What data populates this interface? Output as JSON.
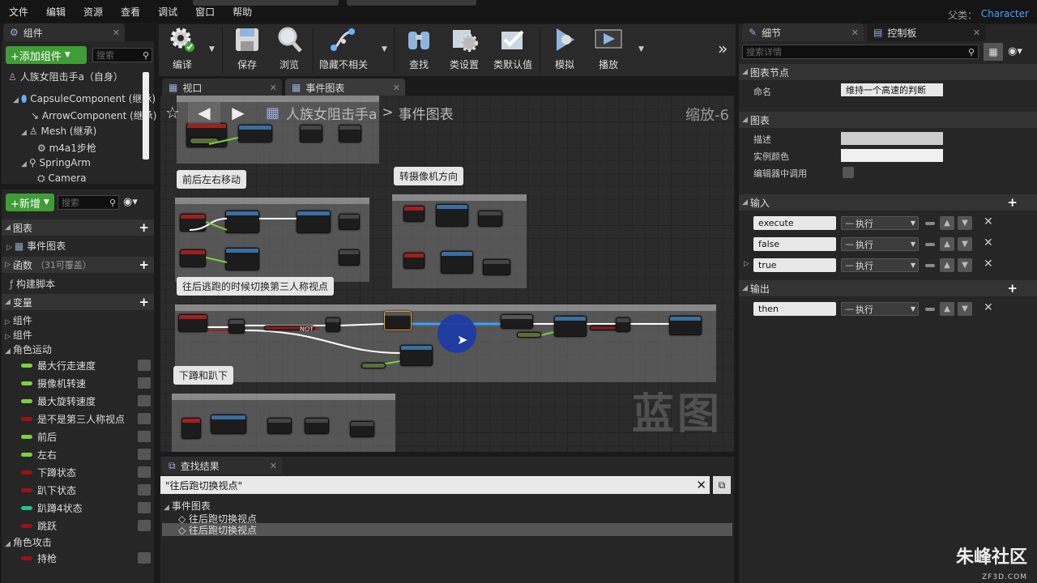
{
  "menu": [
    "文件",
    "编辑",
    "资源",
    "查看",
    "调试",
    "窗口",
    "帮助"
  ],
  "parent": {
    "label": "父类：",
    "value": "Character"
  },
  "components": {
    "tab": "组件",
    "add_button": "+添加组件",
    "search_placeholder": "搜索",
    "tree": [
      "人族女阻击手a（自身）",
      "CapsuleComponent (继承)",
      "ArrowComponent (继承)",
      "Mesh (继承)",
      "m4a1步枪",
      "SpringArm",
      "Camera"
    ]
  },
  "my_blueprint": {
    "new_button": "+新增",
    "search_placeholder": "搜索",
    "sections": {
      "graphs": "图表",
      "event_graph": "事件图表",
      "functions": "函数",
      "functions_override": "（31可覆盖）",
      "construction": "构建脚本",
      "variables": "变量"
    },
    "categories": [
      "组件",
      "组件",
      "角色运动"
    ],
    "variables": [
      {
        "name": "最大行走速度",
        "color": "#7bd23b"
      },
      {
        "name": "摄像机转速",
        "color": "#7bd23b"
      },
      {
        "name": "最大旋转速度",
        "color": "#7bd23b"
      },
      {
        "name": "是不是第三人称视点",
        "color": "#a01010"
      },
      {
        "name": "前后",
        "color": "#7bd23b"
      },
      {
        "name": "左右",
        "color": "#7bd23b"
      },
      {
        "name": "下蹲状态",
        "color": "#a01010"
      },
      {
        "name": "趴下状态",
        "color": "#a01010"
      },
      {
        "name": "趴蹲4状态",
        "color": "#1ec28a"
      },
      {
        "name": "跳跃",
        "color": "#a01010"
      }
    ],
    "attack_category": "角色攻击",
    "attack_variables": [
      {
        "name": "持枪",
        "color": "#a01010"
      }
    ]
  },
  "toolbar": {
    "compile": "编译",
    "save": "保存",
    "browse": "浏览",
    "hide_unrelated": "隐藏不相关",
    "find": "查找",
    "class_settings": "类设置",
    "class_defaults": "类默认值",
    "simulate": "模拟",
    "play": "播放"
  },
  "editor_tabs": {
    "viewport": "视口",
    "event_graph": "事件图表"
  },
  "graph": {
    "breadcrumb_root": "人族女阻击手a",
    "breadcrumb_sep": ">",
    "breadcrumb_leaf": "事件图表",
    "zoom": "缩放-6",
    "watermark": "蓝图",
    "comments": [
      "前后左右移动",
      "转摄像机方向",
      "往后逃跑的时候切换第三人称视点",
      "下蹲和趴下"
    ],
    "not_label": "NOT"
  },
  "find_results": {
    "tab": "查找结果",
    "query": "\"往后跑切换视点\"",
    "root": "事件图表",
    "items": [
      "往后跑切换视点",
      "往后跑切换视点"
    ]
  },
  "details": {
    "tab": "细节",
    "tab2": "控制板",
    "search_placeholder": "搜索详情",
    "graph_node_section": "图表节点",
    "name_label": "命名",
    "name_value": "维持一个高速的判断",
    "graph_section": "图表",
    "desc_label": "描述",
    "color_label": "实例颜色",
    "editor_call_label": "编辑器中调用",
    "inputs_section": "输入",
    "inputs": [
      {
        "name": "execute",
        "type": "执行"
      },
      {
        "name": "false",
        "type": "执行"
      },
      {
        "name": "true",
        "type": "执行"
      }
    ],
    "outputs_section": "输出",
    "outputs": [
      {
        "name": "then",
        "type": "执行"
      }
    ]
  },
  "brand": {
    "name": "朱峰社区",
    "url": "ZF3D.COM"
  }
}
